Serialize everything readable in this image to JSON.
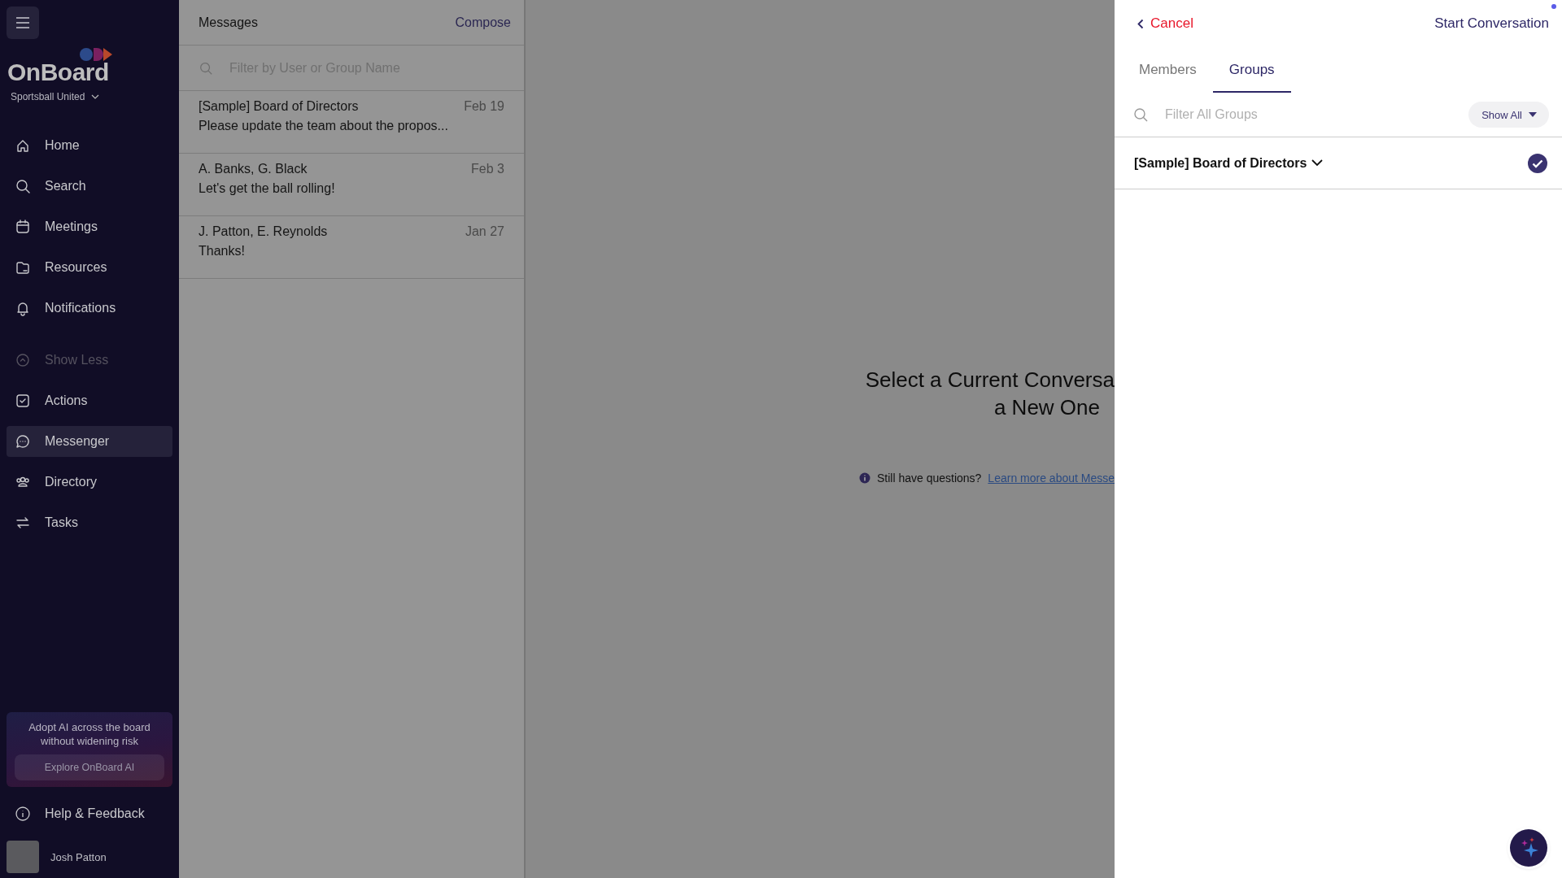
{
  "sidebar": {
    "brand": "OnBoard",
    "organization": "Sportsball United",
    "items": [
      {
        "label": "Home",
        "kind": "link",
        "selected": false
      },
      {
        "label": "Search",
        "kind": "link",
        "selected": false
      },
      {
        "label": "Meetings",
        "kind": "link",
        "selected": false
      },
      {
        "label": "Resources",
        "kind": "link",
        "selected": false
      },
      {
        "label": "Notifications",
        "kind": "link",
        "selected": false
      },
      {
        "label": "Show Less",
        "kind": "toggle",
        "selected": false
      },
      {
        "label": "Actions",
        "kind": "link",
        "selected": false
      },
      {
        "label": "Messenger",
        "kind": "link",
        "selected": true
      },
      {
        "label": "Directory",
        "kind": "link",
        "selected": false
      },
      {
        "label": "Tasks",
        "kind": "link",
        "selected": false
      }
    ],
    "promo": {
      "text": "Adopt AI across the board without widening risk",
      "button": "Explore OnBoard AI"
    },
    "help": "Help & Feedback",
    "user": {
      "name": "Josh Patton"
    }
  },
  "messages": {
    "title": "Messages",
    "compose": "Compose",
    "search": {
      "placeholder": "Filter by User or Group Name"
    },
    "conversations": [
      {
        "name": "[Sample] Board of Directors",
        "date": "Feb 19",
        "preview": "Please update the team about the propos..."
      },
      {
        "name": "A. Banks, G. Black",
        "date": "Feb 3",
        "preview": "Let's get the ball rolling!"
      },
      {
        "name": "J. Patton, E. Reynolds",
        "date": "Jan 27",
        "preview": "Thanks!"
      }
    ]
  },
  "center": {
    "heading_lines": [
      "Select a Current Conversa",
      "a New One"
    ],
    "help_text": "Still have questions?",
    "help_link": "Learn more about Messe"
  },
  "panel": {
    "cancel": "Cancel",
    "start": "Start Conversation",
    "tabs": [
      {
        "label": "Members",
        "selected": false
      },
      {
        "label": "Groups",
        "selected": true
      }
    ],
    "search": {
      "placeholder": "Filter All Groups"
    },
    "filter": "Show All",
    "groups": [
      {
        "name": "[Sample] Board of Directors",
        "checked": true
      }
    ]
  }
}
